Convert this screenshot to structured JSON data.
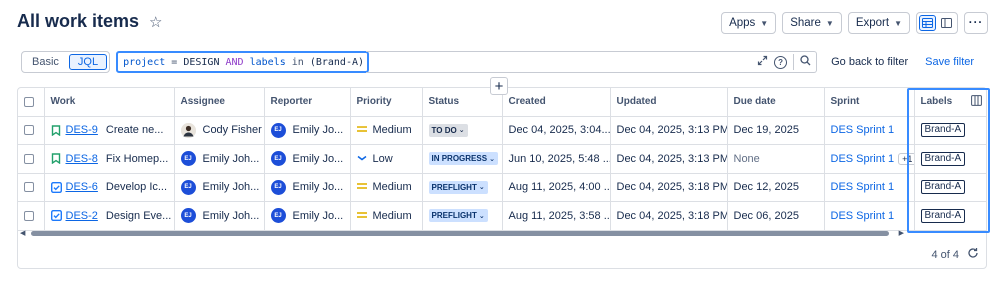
{
  "page": {
    "title": "All work items"
  },
  "toolbar": {
    "apps": "Apps",
    "share": "Share",
    "export": "Export"
  },
  "search": {
    "mode_basic": "Basic",
    "mode_jql": "JQL",
    "query_field": "project",
    "query_eq": "=",
    "query_project": "DESIGN",
    "query_and": "AND",
    "query_field2": "labels",
    "query_in": "in",
    "query_value": "(Brand-A)",
    "go_back": "Go back to filter",
    "save": "Save filter"
  },
  "table": {
    "columns": {
      "work": "Work",
      "assignee": "Assignee",
      "reporter": "Reporter",
      "priority": "Priority",
      "status": "Status",
      "created": "Created",
      "updated": "Updated",
      "due": "Due date",
      "sprint": "Sprint",
      "labels": "Labels"
    },
    "rows": [
      {
        "type": "story",
        "key": "DES-9",
        "summary": "Create ne...",
        "assignee": "Cody Fisher",
        "assignee_initials": "",
        "reporter": "Emily Jo...",
        "reporter_initials": "EJ",
        "priority": "Medium",
        "status": "TO DO",
        "created": "Dec 04, 2025, 3:04...",
        "updated": "Dec 04, 2025, 3:13 PM",
        "due": "Dec 19, 2025",
        "sprint": "DES Sprint 1",
        "sprint_more": "",
        "label": "Brand-A"
      },
      {
        "type": "story",
        "key": "DES-8",
        "summary": "Fix Homep...",
        "assignee": "Emily Joh...",
        "assignee_initials": "EJ",
        "reporter": "Emily Jo...",
        "reporter_initials": "EJ",
        "priority": "Low",
        "status": "IN PROGRESS",
        "created": "Jun 10, 2025, 5:48 ...",
        "updated": "Dec 04, 2025, 3:13 PM",
        "due": "None",
        "sprint": "DES Sprint 1",
        "sprint_more": "+1",
        "label": "Brand-A"
      },
      {
        "type": "task",
        "key": "DES-6",
        "summary": "Develop Ic...",
        "assignee": "Emily Joh...",
        "assignee_initials": "EJ",
        "reporter": "Emily Jo...",
        "reporter_initials": "EJ",
        "priority": "Medium",
        "status": "PREFLIGHT",
        "created": "Aug 11, 2025, 4:00 ...",
        "updated": "Dec 04, 2025, 3:18 PM",
        "due": "Dec 12, 2025",
        "sprint": "DES Sprint 1",
        "sprint_more": "",
        "label": "Brand-A"
      },
      {
        "type": "task",
        "key": "DES-2",
        "summary": "Design Eve...",
        "assignee": "Emily Joh...",
        "assignee_initials": "EJ",
        "reporter": "Emily Jo...",
        "reporter_initials": "EJ",
        "priority": "Medium",
        "status": "PREFLIGHT",
        "created": "Aug 11, 2025, 3:58 ...",
        "updated": "Dec 04, 2025, 3:18 PM",
        "due": "Dec 06, 2025",
        "sprint": "DES Sprint 1",
        "sprint_more": "",
        "label": "Brand-A"
      }
    ]
  },
  "footer": {
    "count": "4 of 4"
  },
  "colors": {
    "accent": "#0c66e4",
    "highlight": "#388bff",
    "medium_priority": "#e2b203",
    "low_priority": "#0c66e4"
  }
}
